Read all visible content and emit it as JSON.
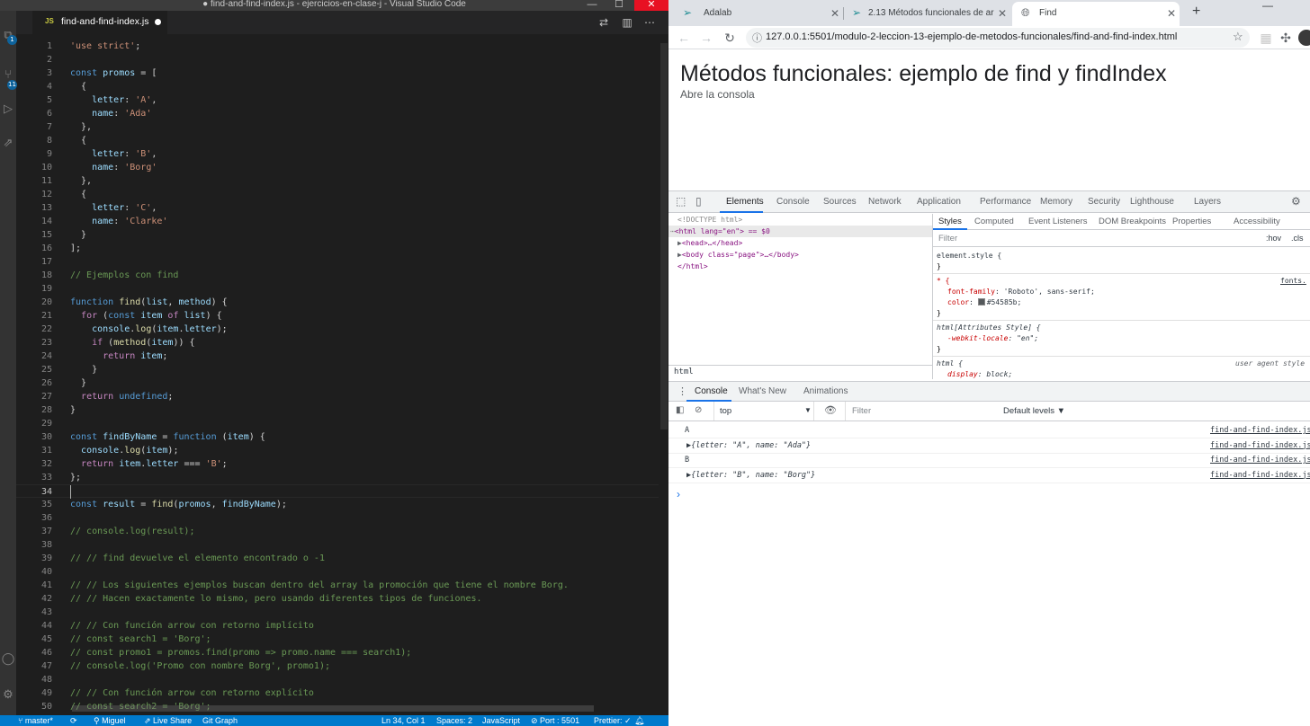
{
  "vscode": {
    "window_title": "● find-and-find-index.js - ejercicios-en-clase-j - Visual Studio Code",
    "tab": {
      "icon": "JS",
      "label": "find-and-find-index.js"
    },
    "badges": {
      "explorer": "1",
      "source_control": "11"
    },
    "lines": [
      "'use strict';",
      "",
      "const promos = [",
      "  {",
      "    letter: 'A',",
      "    name: 'Ada'",
      "  },",
      "  {",
      "    letter: 'B',",
      "    name: 'Borg'",
      "  },",
      "  {",
      "    letter: 'C',",
      "    name: 'Clarke'",
      "  }",
      "];",
      "",
      "// Ejemplos con find",
      "",
      "function find(list, method) {",
      "  for (const item of list) {",
      "    console.log(item.letter);",
      "    if (method(item)) {",
      "      return item;",
      "    }",
      "  }",
      "  return undefined;",
      "}",
      "",
      "const findByName = function (item) {",
      "  console.log(item);",
      "  return item.letter === 'B';",
      "};",
      "",
      "const result = find(promos, findByName);",
      "",
      "// console.log(result);",
      "",
      "// // find devuelve el elemento encontrado o -1",
      "",
      "// // Los siguientes ejemplos buscan dentro del array la promoción que tiene el nombre Borg.",
      "// // Hacen exactamente lo mismo, pero usando diferentes tipos de funciones.",
      "",
      "// // Con función arrow con retorno implícito",
      "// const search1 = 'Borg';",
      "// const promo1 = promos.find(promo => promo.name === search1);",
      "// console.log('Promo con nombre Borg', promo1);",
      "",
      "// // Con función arrow con retorno explícito",
      "// const search2 = 'Borg';"
    ],
    "statusbar": {
      "branch": "master*",
      "user": "Miguel",
      "live_share": "Live Share",
      "git_graph": "Git Graph",
      "position": "Ln 34, Col 1",
      "spaces": "Spaces: 2",
      "language": "JavaScript",
      "port": "Port : 5501",
      "prettier": "Prettier: ✓"
    }
  },
  "chrome": {
    "tabs": [
      {
        "title": "Adalab",
        "icon": "adalab-icon",
        "active": false
      },
      {
        "title": "2.13 Métodos funcionales de arr",
        "icon": "adalab-icon",
        "active": false
      },
      {
        "title": "Find",
        "icon": "globe-icon",
        "active": true
      }
    ],
    "url": "127.0.0.1:5501/modulo-2-leccion-13-ejemplo-de-metodos-funcionales/find-and-find-index.html",
    "page": {
      "heading": "Métodos funcionales: ejemplo de find y findIndex",
      "paragraph": "Abre la consola"
    },
    "devtools": {
      "tabs": [
        "Elements",
        "Console",
        "Sources",
        "Network",
        "Application",
        "Performance",
        "Memory",
        "Security",
        "Lighthouse",
        "Layers"
      ],
      "active_tab": "Elements",
      "elements": {
        "doctype": "<!DOCTYPE html>",
        "html_open": "<html lang=\"en\"> == $0",
        "head": "<head>…</head>",
        "body": "<body class=\"page\">…</body>",
        "html_close": "</html>",
        "breadcrumb": "html"
      },
      "styles_tabs": [
        "Styles",
        "Computed",
        "Event Listeners",
        "DOM Breakpoints",
        "Properties",
        "Accessibility"
      ],
      "styles": {
        "filter_placeholder": "Filter",
        "hov": ":hov",
        "cls": ".cls",
        "element_style": "element.style {",
        "close_brace": "}",
        "universal_selector": "* {",
        "font_family_prop": "font-family",
        "font_family_val": "'Roboto', sans-serif;",
        "color_prop": "color",
        "color_val": "#54585b;",
        "color_swatch": "#54585b",
        "source_link": "fonts.",
        "attr_style_selector": "html[Attributes Style] {",
        "locale_prop": "-webkit-locale",
        "locale_val": "\"en\";",
        "html_selector": "html {",
        "ua_label": "user agent style",
        "display_prop": "display",
        "display_val": "block;"
      },
      "drawer_tabs": [
        "Console",
        "What's New",
        "Animations"
      ],
      "console": {
        "context": "top",
        "filter_placeholder": "Filter",
        "levels": "Default levels ▼",
        "rows": [
          {
            "message": "A",
            "source": "find-and-find-index.js"
          },
          {
            "message": "▶{letter: \"A\", name: \"Ada\"}",
            "source": "find-and-find-index.js"
          },
          {
            "message": "B",
            "source": "find-and-find-index.js"
          },
          {
            "message": "▶{letter: \"B\", name: \"Borg\"}",
            "source": "find-and-find-index.js"
          }
        ],
        "prompt": "›"
      }
    }
  }
}
